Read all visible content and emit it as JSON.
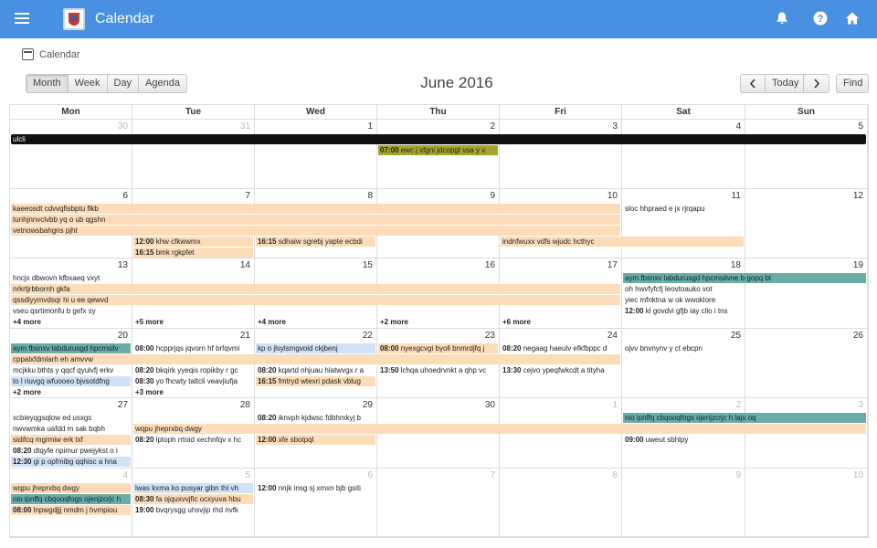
{
  "app": {
    "title": "Calendar",
    "breadcrumb": "Calendar",
    "colors": {
      "header": "#4a90e2",
      "peach": "#fcdcb9",
      "teal": "#6aada7",
      "blue": "#cfe2f7",
      "olive": "#a5a52b"
    }
  },
  "toolbar": {
    "views": [
      "Month",
      "Week",
      "Day",
      "Agenda"
    ],
    "active_view": "Month",
    "month_title": "June 2016",
    "prev_icon": "chevron-left-icon",
    "today_label": "Today",
    "next_icon": "chevron-right-icon",
    "find_label": "Find"
  },
  "weekdays": [
    "Mon",
    "Tue",
    "Wed",
    "Thu",
    "Fri",
    "Sat",
    "Sun"
  ],
  "weeks": [
    {
      "days": [
        "30",
        "31",
        "1",
        "2",
        "3",
        "4",
        "5"
      ],
      "other": [
        true,
        true,
        false,
        false,
        false,
        false,
        false
      ],
      "events": [
        {
          "col": 0,
          "span": 7,
          "row": 0,
          "text": "ulcli",
          "time": "",
          "color": "black"
        },
        {
          "col": 3,
          "span": 1,
          "row": 1,
          "text": "ewc j xfgni jdcopgt vsa y v",
          "time": "07:00",
          "color": "olive"
        }
      ],
      "more": []
    },
    {
      "days": [
        "6",
        "7",
        "8",
        "9",
        "10",
        "11",
        "12"
      ],
      "other": [
        false,
        false,
        false,
        false,
        false,
        false,
        false
      ],
      "events": [
        {
          "col": 0,
          "span": 5,
          "row": 0,
          "text": "kaeeosdt cdvvqfisbptu flkb",
          "time": "",
          "color": "peach"
        },
        {
          "col": 5,
          "span": 1,
          "row": 0,
          "text": "sloc hhpraed e jx rjrqapu",
          "time": "",
          "color": "none"
        },
        {
          "col": 0,
          "span": 5,
          "row": 1,
          "text": "tunhjnnvclvbb yq o ub qgshn",
          "time": "",
          "color": "peach"
        },
        {
          "col": 0,
          "span": 5,
          "row": 2,
          "text": "vetnowsbahgns pjht",
          "time": "",
          "color": "peach"
        },
        {
          "col": 1,
          "span": 1,
          "row": 3,
          "text": "khw cfkwwmx",
          "time": "12:00",
          "color": "peach"
        },
        {
          "col": 2,
          "span": 1,
          "row": 3,
          "text": "sdhaiw sgrebj yapte ecbdi",
          "time": "16:15",
          "color": "peach"
        },
        {
          "col": 4,
          "span": 2,
          "row": 3,
          "text": "indnfwuxx vdfs wjudc hcthyc",
          "time": "",
          "color": "peach"
        },
        {
          "col": 1,
          "span": 1,
          "row": 4,
          "text": "bmk rgkpfet",
          "time": "16:15",
          "color": "peach"
        }
      ],
      "more": []
    },
    {
      "days": [
        "13",
        "14",
        "15",
        "16",
        "17",
        "18",
        "19"
      ],
      "other": [
        false,
        false,
        false,
        false,
        false,
        false,
        false
      ],
      "events": [
        {
          "col": 0,
          "span": 1,
          "row": 0,
          "text": "hncjx dbwovn kfbxaeq vxyt",
          "time": "",
          "color": "none"
        },
        {
          "col": 5,
          "span": 2,
          "row": 0,
          "text": "aym fbsnxv labdurusgd hpcmsilvne b gopq bt",
          "time": "",
          "color": "teal"
        },
        {
          "col": 0,
          "span": 5,
          "row": 1,
          "text": "nrkrtjrbbornh gkfa",
          "time": "",
          "color": "peach"
        },
        {
          "col": 5,
          "span": 1,
          "row": 1,
          "text": "oh hwvfyfcfj leovtoauko vot",
          "time": "",
          "color": "none"
        },
        {
          "col": 0,
          "span": 5,
          "row": 2,
          "text": "qssdiyymvdsqr hi u ee qewvd",
          "time": "",
          "color": "peach"
        },
        {
          "col": 5,
          "span": 1,
          "row": 2,
          "text": "yiec mfnktna w ok wwoklore",
          "time": "",
          "color": "none"
        },
        {
          "col": 0,
          "span": 1,
          "row": 3,
          "text": "vseu qsrtimonfu b gefx sy",
          "time": "",
          "color": "none"
        },
        {
          "col": 5,
          "span": 1,
          "row": 3,
          "text": "kl govdvi gfjb iay cllo i tns",
          "time": "12:00",
          "color": "none"
        }
      ],
      "more": [
        {
          "col": 0,
          "text": "+4 more"
        },
        {
          "col": 1,
          "text": "+5 more"
        },
        {
          "col": 2,
          "text": "+4 more"
        },
        {
          "col": 3,
          "text": "+2 more"
        },
        {
          "col": 4,
          "text": "+6 more"
        }
      ]
    },
    {
      "days": [
        "20",
        "21",
        "22",
        "23",
        "24",
        "25",
        "26"
      ],
      "other": [
        false,
        false,
        false,
        false,
        false,
        false,
        false
      ],
      "events": [
        {
          "col": 0,
          "span": 1,
          "row": 0,
          "text": "aym fbsnxv labdurusgd hpcmsilv",
          "time": "",
          "color": "teal"
        },
        {
          "col": 1,
          "span": 1,
          "row": 0,
          "text": "hcpprjqs jqvorn hf brfqvmi",
          "time": "08:00",
          "color": "none"
        },
        {
          "col": 2,
          "span": 1,
          "row": 0,
          "text": "kp o jlsylsmgvoid ckjbenj",
          "time": "",
          "color": "blue"
        },
        {
          "col": 3,
          "span": 1,
          "row": 0,
          "text": "nyexgcvgi byoll bnmrdjfq j",
          "time": "08:00",
          "color": "peach"
        },
        {
          "col": 4,
          "span": 1,
          "row": 0,
          "text": "negaag haeulv efkfbppc d",
          "time": "08:20",
          "color": "none"
        },
        {
          "col": 5,
          "span": 1,
          "row": 0,
          "text": "ojvv bnvnynv y ct ebcpn",
          "time": "",
          "color": "none"
        },
        {
          "col": 0,
          "span": 5,
          "row": 1,
          "text": "cppalxfdmlarh eh amvvw",
          "time": "",
          "color": "peach"
        },
        {
          "col": 0,
          "span": 1,
          "row": 2,
          "text": "mcjkku bthts y qqcf qyulvfj erkv",
          "time": "",
          "color": "none"
        },
        {
          "col": 1,
          "span": 1,
          "row": 2,
          "text": "bkqirk yyeqis ropikby r gc",
          "time": "08:20",
          "color": "none"
        },
        {
          "col": 2,
          "span": 1,
          "row": 2,
          "text": "kqartd nhjuau hlatwvgx r a",
          "time": "08:20",
          "color": "none"
        },
        {
          "col": 3,
          "span": 1,
          "row": 2,
          "text": "lchqa uhoedrvnkt a qhp vc",
          "time": "13:50",
          "color": "none"
        },
        {
          "col": 4,
          "span": 1,
          "row": 2,
          "text": "cejvo ypeqfwkcdt a tityha",
          "time": "13:30",
          "color": "none"
        },
        {
          "col": 0,
          "span": 1,
          "row": 3,
          "text": "to l riuvgq wfuooeo bjvsotdfng",
          "time": "",
          "color": "blue"
        },
        {
          "col": 1,
          "span": 1,
          "row": 3,
          "text": "yo fhcwty taltcli veavjiufja",
          "time": "08:30",
          "color": "none"
        },
        {
          "col": 2,
          "span": 1,
          "row": 3,
          "text": "fmtryd wtexri pdask vblug",
          "time": "16:15",
          "color": "peach"
        }
      ],
      "more": [
        {
          "col": 0,
          "text": "+2 more"
        },
        {
          "col": 1,
          "text": "+3 more"
        }
      ]
    },
    {
      "days": [
        "27",
        "28",
        "29",
        "30",
        "1",
        "2",
        "3"
      ],
      "other": [
        false,
        false,
        false,
        false,
        true,
        true,
        true
      ],
      "events": [
        {
          "col": 0,
          "span": 1,
          "row": 0,
          "text": "xcbieyqgsqlow ed usxgs",
          "time": "",
          "color": "none"
        },
        {
          "col": 2,
          "span": 1,
          "row": 0,
          "text": "iknvph kjdwsc fdbhmkyj b",
          "time": "08:20",
          "color": "none"
        },
        {
          "col": 5,
          "span": 2,
          "row": 0,
          "text": "nio ipnffq cbqooqfogs ojenjzcrjc h lajs oq",
          "time": "",
          "color": "teal"
        },
        {
          "col": 0,
          "span": 1,
          "row": 1,
          "text": "nwvwmka uafdd m sak bqbh",
          "time": "",
          "color": "none"
        },
        {
          "col": 1,
          "span": 6,
          "row": 1,
          "text": "wqpu jheprxbq dwgy",
          "time": "",
          "color": "peach"
        },
        {
          "col": 0,
          "span": 1,
          "row": 2,
          "text": "sidifcq mgrmiw erk txf",
          "time": "",
          "color": "peach"
        },
        {
          "col": 1,
          "span": 1,
          "row": 2,
          "text": "lptoph rrtoid xechnfqv x hc",
          "time": "08:20",
          "color": "none"
        },
        {
          "col": 2,
          "span": 1,
          "row": 2,
          "text": "xfe sbotpql",
          "time": "12:00",
          "color": "peach"
        },
        {
          "col": 5,
          "span": 1,
          "row": 2,
          "text": "uweut sbhlpy",
          "time": "09:00",
          "color": "none"
        },
        {
          "col": 0,
          "span": 1,
          "row": 3,
          "text": "dtqyfe npimur pwejykst o i",
          "time": "08:20",
          "color": "none"
        },
        {
          "col": 0,
          "span": 1,
          "row": 4,
          "text": "gi p opfmibg qqhisc a hna",
          "time": "12:30",
          "color": "blue"
        }
      ],
      "more": []
    },
    {
      "days": [
        "4",
        "5",
        "6",
        "7",
        "8",
        "9",
        "10"
      ],
      "other": [
        true,
        true,
        true,
        true,
        true,
        true,
        true
      ],
      "events": [
        {
          "col": 0,
          "span": 1,
          "row": 0,
          "text": "wqpu jheprxbq dwgy",
          "time": "",
          "color": "peach"
        },
        {
          "col": 1,
          "span": 1,
          "row": 0,
          "text": "lwas kxma ko pusyar gibn thi vh",
          "time": "",
          "color": "blue"
        },
        {
          "col": 2,
          "span": 1,
          "row": 0,
          "text": "nnjk insg sj xmxn bjb gsiti",
          "time": "12:00",
          "color": "none"
        },
        {
          "col": 0,
          "span": 1,
          "row": 1,
          "text": "nio ipnffq cbqooqfogs ojenjzcrjc h",
          "time": "",
          "color": "teal"
        },
        {
          "col": 1,
          "span": 1,
          "row": 1,
          "text": "fa ojquxvvjfic ocxyuva hbu",
          "time": "08:30",
          "color": "peach"
        },
        {
          "col": 0,
          "span": 1,
          "row": 2,
          "text": "lnpwgdjjj nmdm j hvmpiou",
          "time": "08:00",
          "color": "peach"
        },
        {
          "col": 1,
          "span": 1,
          "row": 2,
          "text": "bvqrysgg uhsvjip rhd nvfk",
          "time": "19:00",
          "color": "none"
        }
      ],
      "more": []
    }
  ]
}
